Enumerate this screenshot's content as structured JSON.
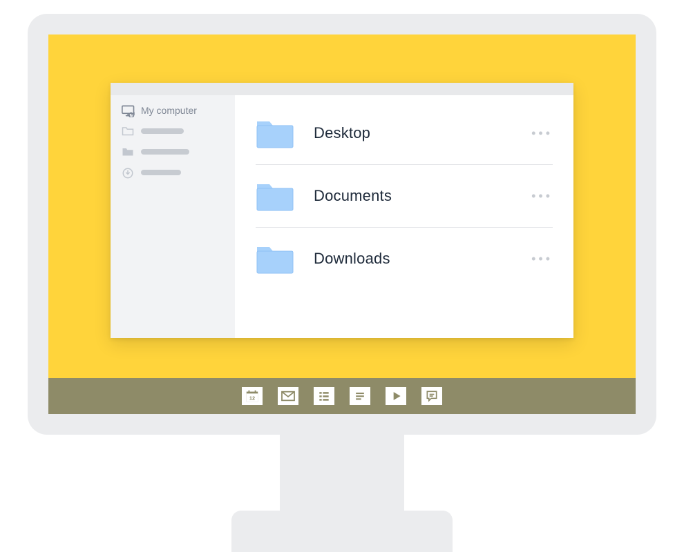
{
  "sidebar": {
    "active_label": "My computer"
  },
  "folders": [
    {
      "name": "Desktop"
    },
    {
      "name": "Documents"
    },
    {
      "name": "Downloads"
    }
  ],
  "taskbar": {
    "calendar_day": "12"
  },
  "colors": {
    "desktop": "#FFD43B",
    "taskbar": "#8E8B68",
    "folder_fill": "#A7D1FB",
    "folder_stroke": "#8FC1F5"
  }
}
